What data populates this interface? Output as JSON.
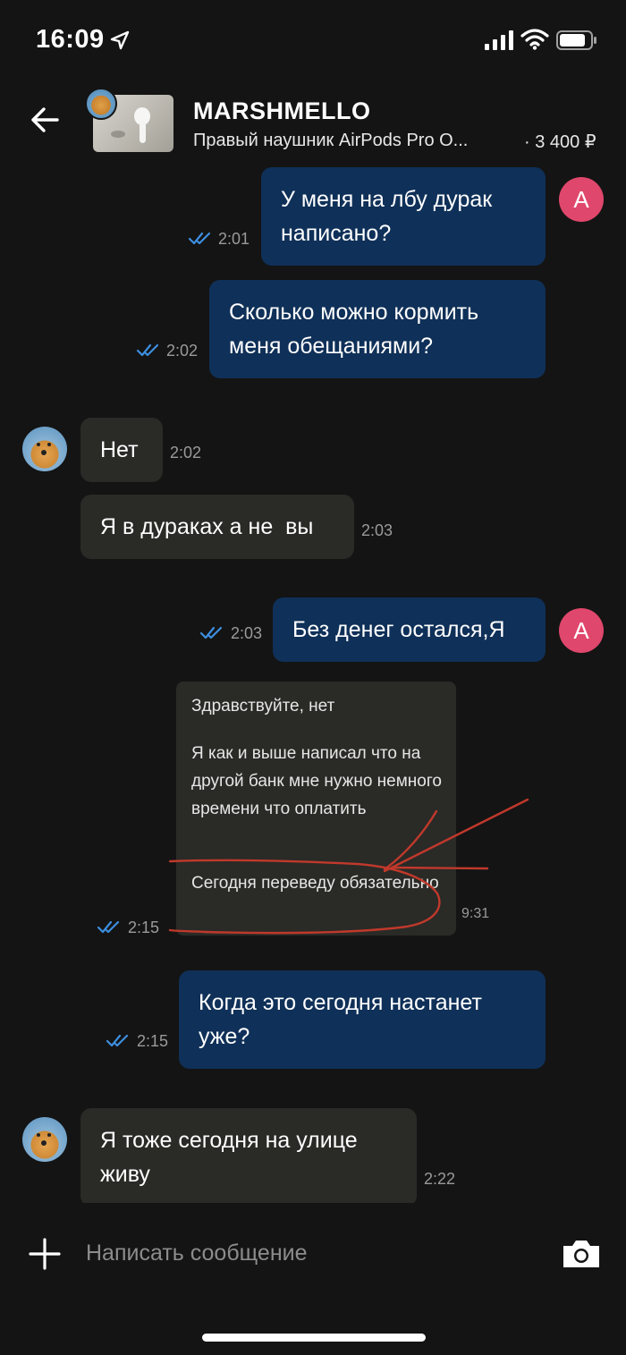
{
  "status_bar": {
    "time": "16:09"
  },
  "header": {
    "title": "MARSHMELLO",
    "product": "Правый наушник AirPods Pro O...",
    "price": "· 3 400 ₽"
  },
  "user_initial": "А",
  "messages": [
    {
      "id": "m1",
      "dir": "out",
      "text": "У меня на лбу дурак написано?",
      "time": "2:01",
      "read": true
    },
    {
      "id": "m2",
      "dir": "out",
      "text": "Сколько можно кормить меня обещаниями?",
      "time": "2:02",
      "read": true
    },
    {
      "id": "m3",
      "dir": "in",
      "text": "Нет",
      "time": "2:02"
    },
    {
      "id": "m4",
      "dir": "in",
      "text": "Я в дураках а не  вы",
      "time": "2:03"
    },
    {
      "id": "m5",
      "dir": "out",
      "text": "Без денег остался,Я",
      "time": "2:03",
      "read": true
    },
    {
      "id": "m6",
      "dir": "out",
      "type": "screenshot",
      "time": "2:15",
      "read": true,
      "quote": {
        "line1": "Здравствуйте, нет",
        "line2": "Я как и выше написал что на другой банк мне нужно немного времени что оплатить",
        "line3": "Сегодня переведу обязательно",
        "time": "9:31"
      }
    },
    {
      "id": "m7",
      "dir": "out",
      "text": "Когда это сегодня настанет уже?",
      "time": "2:15",
      "read": true
    },
    {
      "id": "m8",
      "dir": "in",
      "text": "Я тоже сегодня на улице живу",
      "time": "2:22"
    }
  ],
  "input": {
    "placeholder": "Написать сообщение"
  },
  "colors": {
    "background": "#141414",
    "outgoing_bubble": "#0f3058",
    "incoming_bubble": "#2a2a27",
    "read_check": "#3d8fe0",
    "user_avatar": "#e0476c",
    "annotation": "#c0392b"
  }
}
